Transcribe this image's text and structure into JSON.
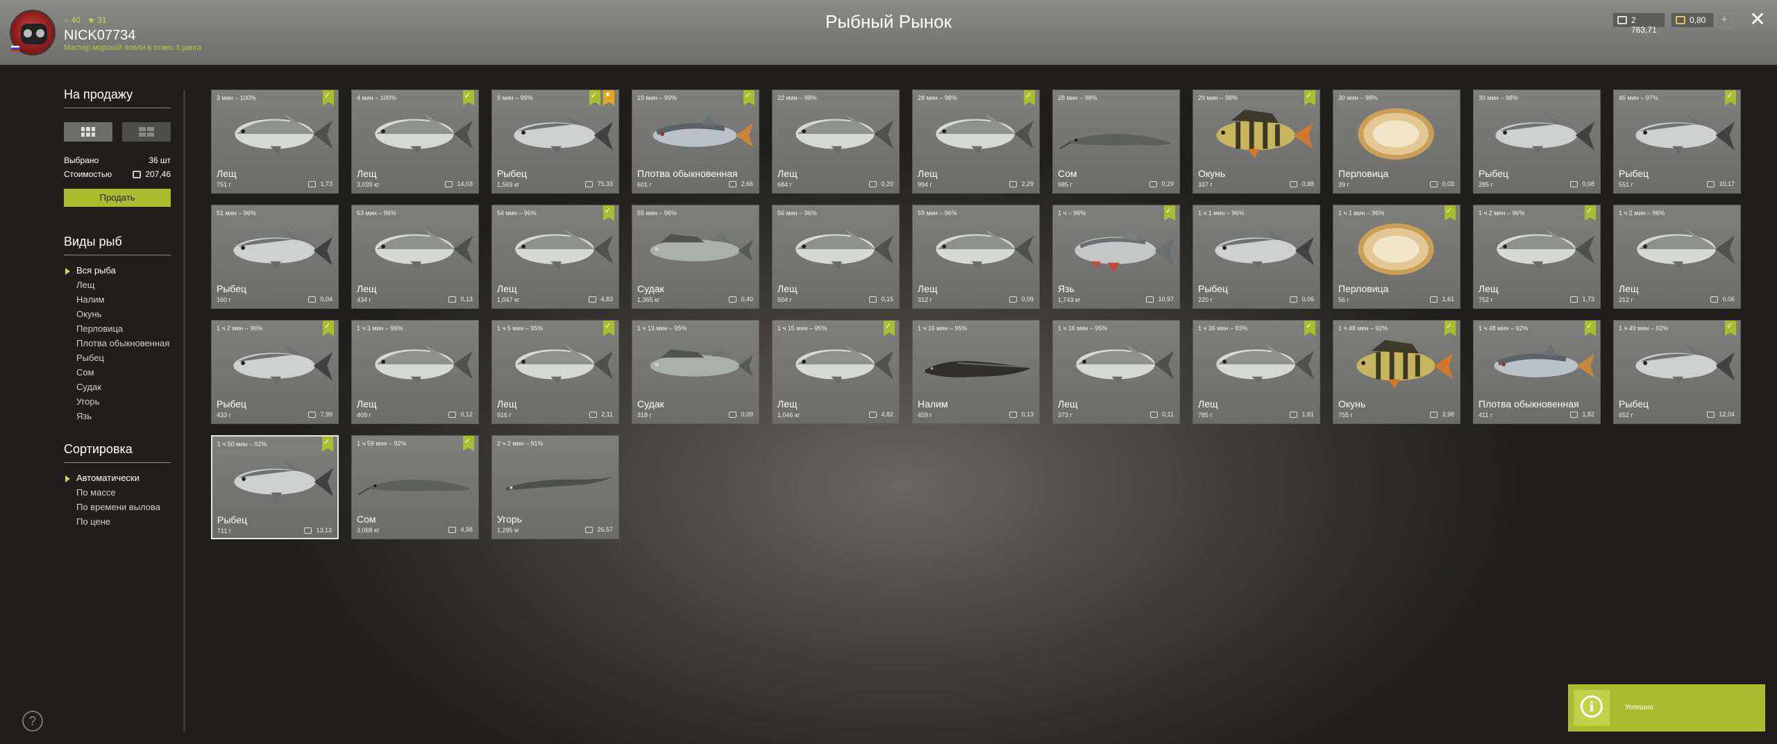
{
  "header": {
    "title": "Рыбный Рынок",
    "stat_a": "40",
    "stat_b": "31",
    "username": "NICK07734",
    "rank": "Мастер морской ловли в отвес 3 ранга",
    "silver": "2 763,71",
    "gold": "0,80",
    "plus_label": "+",
    "close_label": "✕"
  },
  "sidebar": {
    "for_sale_title": "На продажу",
    "selected_label": "Выбрано",
    "selected_value": "36 шт",
    "cost_label": "Стоимостью",
    "cost_value": "207,46",
    "sell_label": "Продать",
    "fish_types_title": "Виды рыб",
    "fish_types": [
      "Вся рыба",
      "Лещ",
      "Налим",
      "Окунь",
      "Перловица",
      "Плотва обыкновенная",
      "Рыбец",
      "Сом",
      "Судак",
      "Угорь",
      "Язь"
    ],
    "sort_title": "Сортировка",
    "sort_options": [
      "Автоматически",
      "По массе",
      "По времени вылова",
      "По цене"
    ]
  },
  "cards": [
    {
      "time": "3 мин – 100%",
      "name": "Лещ",
      "weight": "751 г",
      "price": "1,73",
      "check": true,
      "fish": "bream"
    },
    {
      "time": "4 мин – 100%",
      "name": "Лещ",
      "weight": "3,039 кг",
      "price": "14,03",
      "check": true,
      "fish": "bream"
    },
    {
      "time": "9 мин – 99%",
      "name": "Рыбец",
      "weight": "1,569 кг",
      "price": "75,33",
      "check": true,
      "star": true,
      "fish": "vimba"
    },
    {
      "time": "19 мин – 99%",
      "name": "Плотва обыкновенная",
      "weight": "601 г",
      "price": "2,66",
      "check": true,
      "fish": "roach"
    },
    {
      "time": "22 мин – 98%",
      "name": "Лещ",
      "weight": "684 г",
      "price": "0,20",
      "check": false,
      "fish": "bream"
    },
    {
      "time": "28 мин – 98%",
      "name": "Лещ",
      "weight": "994 г",
      "price": "2,29",
      "check": true,
      "fish": "bream"
    },
    {
      "time": "28 мин – 98%",
      "name": "Сом",
      "weight": "985 г",
      "price": "0,29",
      "check": false,
      "fish": "catfish"
    },
    {
      "time": "29 мин – 98%",
      "name": "Окунь",
      "weight": "337 г",
      "price": "0,88",
      "check": true,
      "fish": "perch"
    },
    {
      "time": "30 мин – 98%",
      "name": "Перловица",
      "weight": "39 г",
      "price": "0,03",
      "check": false,
      "fish": "mussel"
    },
    {
      "time": "30 мин – 98%",
      "name": "Рыбец",
      "weight": "285 г",
      "price": "0,08",
      "check": false,
      "fish": "vimba"
    },
    {
      "time": "46 мин – 97%",
      "name": "Рыбец",
      "weight": "551 г",
      "price": "10,17",
      "check": true,
      "fish": "vimba"
    },
    {
      "time": "51 мин – 96%",
      "name": "Рыбец",
      "weight": "160 г",
      "price": "0,04",
      "check": false,
      "fish": "vimba"
    },
    {
      "time": "53 мин – 96%",
      "name": "Лещ",
      "weight": "434 г",
      "price": "0,13",
      "check": false,
      "fish": "bream"
    },
    {
      "time": "54 мин – 96%",
      "name": "Лещ",
      "weight": "1,047 кг",
      "price": "4,83",
      "check": true,
      "fish": "bream"
    },
    {
      "time": "55 мин – 96%",
      "name": "Судак",
      "weight": "1,365 кг",
      "price": "0,40",
      "check": false,
      "fish": "zander"
    },
    {
      "time": "56 мин – 96%",
      "name": "Лещ",
      "weight": "504 г",
      "price": "0,15",
      "check": false,
      "fish": "bream"
    },
    {
      "time": "59 мин – 96%",
      "name": "Лещ",
      "weight": "312 г",
      "price": "0,09",
      "check": false,
      "fish": "bream"
    },
    {
      "time": "1 ч – 96%",
      "name": "Язь",
      "weight": "1,743 кг",
      "price": "10,97",
      "check": true,
      "fish": "ide"
    },
    {
      "time": "1 ч 1 мин – 96%",
      "name": "Рыбец",
      "weight": "220 г",
      "price": "0,06",
      "check": false,
      "fish": "vimba"
    },
    {
      "time": "1 ч 1 мин – 96%",
      "name": "Перловица",
      "weight": "56 г",
      "price": "1,61",
      "check": true,
      "fish": "mussel"
    },
    {
      "time": "1 ч 2 мин – 96%",
      "name": "Лещ",
      "weight": "752 г",
      "price": "1,73",
      "check": true,
      "fish": "bream"
    },
    {
      "time": "1 ч 2 мин – 96%",
      "name": "Лещ",
      "weight": "212 г",
      "price": "0,06",
      "check": false,
      "fish": "bream"
    },
    {
      "time": "1 ч 2 мин – 96%",
      "name": "Рыбец",
      "weight": "433 г",
      "price": "7,99",
      "check": true,
      "fish": "vimba"
    },
    {
      "time": "1 ч 3 мин – 96%",
      "name": "Лещ",
      "weight": "409 г",
      "price": "0,12",
      "check": false,
      "fish": "bream"
    },
    {
      "time": "1 ч 5 мин – 95%",
      "name": "Лещ",
      "weight": "916 г",
      "price": "2,11",
      "check": true,
      "fish": "bream"
    },
    {
      "time": "1 ч 13 мин – 95%",
      "name": "Судак",
      "weight": "318 г",
      "price": "0,09",
      "check": false,
      "fish": "zander"
    },
    {
      "time": "1 ч 15 мин – 95%",
      "name": "Лещ",
      "weight": "1,046 кг",
      "price": "4,82",
      "check": true,
      "fish": "bream"
    },
    {
      "time": "1 ч 16 мин – 95%",
      "name": "Налим",
      "weight": "459 г",
      "price": "0,13",
      "check": false,
      "fish": "burbot"
    },
    {
      "time": "1 ч 16 мин – 95%",
      "name": "Лещ",
      "weight": "373 г",
      "price": "0,11",
      "check": false,
      "fish": "bream"
    },
    {
      "time": "1 ч 36 мин – 93%",
      "name": "Лещ",
      "weight": "785 г",
      "price": "1,81",
      "check": true,
      "fish": "bream"
    },
    {
      "time": "1 ч 48 мин – 92%",
      "name": "Окунь",
      "weight": "755 г",
      "price": "3,98",
      "check": true,
      "fish": "perch"
    },
    {
      "time": "1 ч 48 мин – 92%",
      "name": "Плотва обыкновенная",
      "weight": "411 г",
      "price": "1,82",
      "check": true,
      "fish": "roach"
    },
    {
      "time": "1 ч 49 мин – 92%",
      "name": "Рыбец",
      "weight": "652 г",
      "price": "12,04",
      "check": true,
      "fish": "vimba"
    },
    {
      "time": "1 ч 50 мин – 92%",
      "name": "Рыбец",
      "weight": "711 г",
      "price": "13,13",
      "check": true,
      "fish": "vimba",
      "selected": true
    },
    {
      "time": "1 ч 59 мин – 92%",
      "name": "Сом",
      "weight": "3,068 кг",
      "price": "4,98",
      "check": true,
      "fish": "catfish"
    },
    {
      "time": "2 ч 2 мин – 91%",
      "name": "Угорь",
      "weight": "1,295 кг",
      "price": "26,57",
      "check": false,
      "fish": "eel"
    }
  ],
  "toast": {
    "message": "Успешно",
    "icon": "info-icon"
  },
  "help_label": "?",
  "colors": {
    "accent": "#a9be2e",
    "star": "#e0a81e"
  }
}
